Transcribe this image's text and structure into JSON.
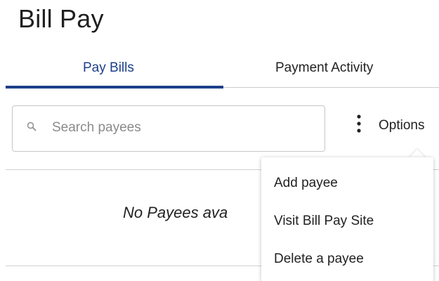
{
  "page": {
    "title": "Bill Pay"
  },
  "tabs": [
    {
      "label": "Pay Bills",
      "active": true
    },
    {
      "label": "Payment Activity",
      "active": false
    }
  ],
  "colors": {
    "accent": "#1c3f8a",
    "divider": "#d0d0d0"
  },
  "search": {
    "placeholder": "Search payees",
    "value": "",
    "icon": "search-icon"
  },
  "options": {
    "label": "Options",
    "icon": "kebab-icon",
    "menu": [
      {
        "label": "Add payee"
      },
      {
        "label": "Visit Bill Pay Site"
      },
      {
        "label": "Delete a payee"
      }
    ]
  },
  "empty_state": {
    "message": "No Payees ava"
  }
}
